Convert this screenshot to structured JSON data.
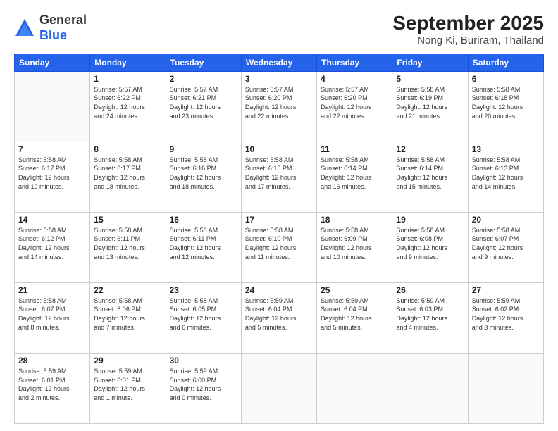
{
  "header": {
    "logo_line1": "General",
    "logo_line2": "Blue",
    "title": "September 2025",
    "subtitle": "Nong Ki, Buriram, Thailand"
  },
  "days_of_week": [
    "Sunday",
    "Monday",
    "Tuesday",
    "Wednesday",
    "Thursday",
    "Friday",
    "Saturday"
  ],
  "weeks": [
    [
      {
        "day": "",
        "info": ""
      },
      {
        "day": "1",
        "info": "Sunrise: 5:57 AM\nSunset: 6:22 PM\nDaylight: 12 hours\nand 24 minutes."
      },
      {
        "day": "2",
        "info": "Sunrise: 5:57 AM\nSunset: 6:21 PM\nDaylight: 12 hours\nand 23 minutes."
      },
      {
        "day": "3",
        "info": "Sunrise: 5:57 AM\nSunset: 6:20 PM\nDaylight: 12 hours\nand 22 minutes."
      },
      {
        "day": "4",
        "info": "Sunrise: 5:57 AM\nSunset: 6:20 PM\nDaylight: 12 hours\nand 22 minutes."
      },
      {
        "day": "5",
        "info": "Sunrise: 5:58 AM\nSunset: 6:19 PM\nDaylight: 12 hours\nand 21 minutes."
      },
      {
        "day": "6",
        "info": "Sunrise: 5:58 AM\nSunset: 6:18 PM\nDaylight: 12 hours\nand 20 minutes."
      }
    ],
    [
      {
        "day": "7",
        "info": "Sunrise: 5:58 AM\nSunset: 6:17 PM\nDaylight: 12 hours\nand 19 minutes."
      },
      {
        "day": "8",
        "info": "Sunrise: 5:58 AM\nSunset: 6:17 PM\nDaylight: 12 hours\nand 18 minutes."
      },
      {
        "day": "9",
        "info": "Sunrise: 5:58 AM\nSunset: 6:16 PM\nDaylight: 12 hours\nand 18 minutes."
      },
      {
        "day": "10",
        "info": "Sunrise: 5:58 AM\nSunset: 6:15 PM\nDaylight: 12 hours\nand 17 minutes."
      },
      {
        "day": "11",
        "info": "Sunrise: 5:58 AM\nSunset: 6:14 PM\nDaylight: 12 hours\nand 16 minutes."
      },
      {
        "day": "12",
        "info": "Sunrise: 5:58 AM\nSunset: 6:14 PM\nDaylight: 12 hours\nand 15 minutes."
      },
      {
        "day": "13",
        "info": "Sunrise: 5:58 AM\nSunset: 6:13 PM\nDaylight: 12 hours\nand 14 minutes."
      }
    ],
    [
      {
        "day": "14",
        "info": "Sunrise: 5:58 AM\nSunset: 6:12 PM\nDaylight: 12 hours\nand 14 minutes."
      },
      {
        "day": "15",
        "info": "Sunrise: 5:58 AM\nSunset: 6:11 PM\nDaylight: 12 hours\nand 13 minutes."
      },
      {
        "day": "16",
        "info": "Sunrise: 5:58 AM\nSunset: 6:11 PM\nDaylight: 12 hours\nand 12 minutes."
      },
      {
        "day": "17",
        "info": "Sunrise: 5:58 AM\nSunset: 6:10 PM\nDaylight: 12 hours\nand 11 minutes."
      },
      {
        "day": "18",
        "info": "Sunrise: 5:58 AM\nSunset: 6:09 PM\nDaylight: 12 hours\nand 10 minutes."
      },
      {
        "day": "19",
        "info": "Sunrise: 5:58 AM\nSunset: 6:08 PM\nDaylight: 12 hours\nand 9 minutes."
      },
      {
        "day": "20",
        "info": "Sunrise: 5:58 AM\nSunset: 6:07 PM\nDaylight: 12 hours\nand 9 minutes."
      }
    ],
    [
      {
        "day": "21",
        "info": "Sunrise: 5:58 AM\nSunset: 6:07 PM\nDaylight: 12 hours\nand 8 minutes."
      },
      {
        "day": "22",
        "info": "Sunrise: 5:58 AM\nSunset: 6:06 PM\nDaylight: 12 hours\nand 7 minutes."
      },
      {
        "day": "23",
        "info": "Sunrise: 5:58 AM\nSunset: 6:05 PM\nDaylight: 12 hours\nand 6 minutes."
      },
      {
        "day": "24",
        "info": "Sunrise: 5:59 AM\nSunset: 6:04 PM\nDaylight: 12 hours\nand 5 minutes."
      },
      {
        "day": "25",
        "info": "Sunrise: 5:59 AM\nSunset: 6:04 PM\nDaylight: 12 hours\nand 5 minutes."
      },
      {
        "day": "26",
        "info": "Sunrise: 5:59 AM\nSunset: 6:03 PM\nDaylight: 12 hours\nand 4 minutes."
      },
      {
        "day": "27",
        "info": "Sunrise: 5:59 AM\nSunset: 6:02 PM\nDaylight: 12 hours\nand 3 minutes."
      }
    ],
    [
      {
        "day": "28",
        "info": "Sunrise: 5:59 AM\nSunset: 6:01 PM\nDaylight: 12 hours\nand 2 minutes."
      },
      {
        "day": "29",
        "info": "Sunrise: 5:59 AM\nSunset: 6:01 PM\nDaylight: 12 hours\nand 1 minute."
      },
      {
        "day": "30",
        "info": "Sunrise: 5:59 AM\nSunset: 6:00 PM\nDaylight: 12 hours\nand 0 minutes."
      },
      {
        "day": "",
        "info": ""
      },
      {
        "day": "",
        "info": ""
      },
      {
        "day": "",
        "info": ""
      },
      {
        "day": "",
        "info": ""
      }
    ]
  ]
}
